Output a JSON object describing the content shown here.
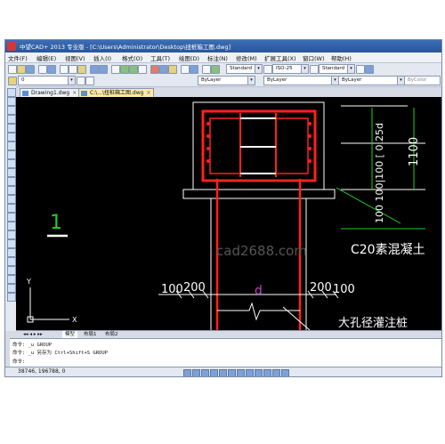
{
  "window": {
    "title": "中望CAD+ 2013 专业版 - [C:\\Users\\Administrator\\Desktop\\扭桩箱工图.dwg]"
  },
  "menu": [
    "文件(F)",
    "编辑(E)",
    "视图(V)",
    "插入(I)",
    "格式(O)",
    "工具(T)",
    "绘图(D)",
    "标注(N)",
    "修改(M)",
    "扩展工具(X)",
    "窗口(W)",
    "帮助(H)"
  ],
  "toolbar": {
    "layer_value": "0",
    "style1": "Standard",
    "style2": "ISO-25",
    "style3": "Standard",
    "color_value": "ByLayer",
    "linetype_value": "ByLayer",
    "lineweight_value": "ByLayer",
    "plotstyle_value": "ByColor"
  },
  "tabs": [
    {
      "label": "Drawing1.dwg"
    },
    {
      "label": "C:\\...\\扭桩箱工图.dwg"
    }
  ],
  "drawing": {
    "label_1": "1",
    "dim_1100": "1100",
    "dim_side": "100 100|100 [ 0.25d",
    "watermark": "cad2688.com",
    "note_concrete": "C20素混凝土",
    "dim_100_left": "100",
    "dim_200_left": "200",
    "dim_200_right": "200",
    "dim_100_right": "100",
    "label_d": "d",
    "note_pile": "大孔径灌注桩",
    "axis_x": "X",
    "axis_y": "Y"
  },
  "layout_tabs": [
    "模型",
    "布局1",
    "布局2"
  ],
  "command": {
    "lines": [
      "命令:  _u  GROUP",
      "命令:  _u  另存为    Ctrl+Shift+S  GROUP",
      "命令:"
    ]
  },
  "status": {
    "coordinates": "38746, 196788, 0"
  },
  "colors": {
    "red": "#ff2020",
    "green": "#22d022",
    "white": "#ffffff",
    "purple": "#c040c0",
    "canvas": "#000000"
  }
}
